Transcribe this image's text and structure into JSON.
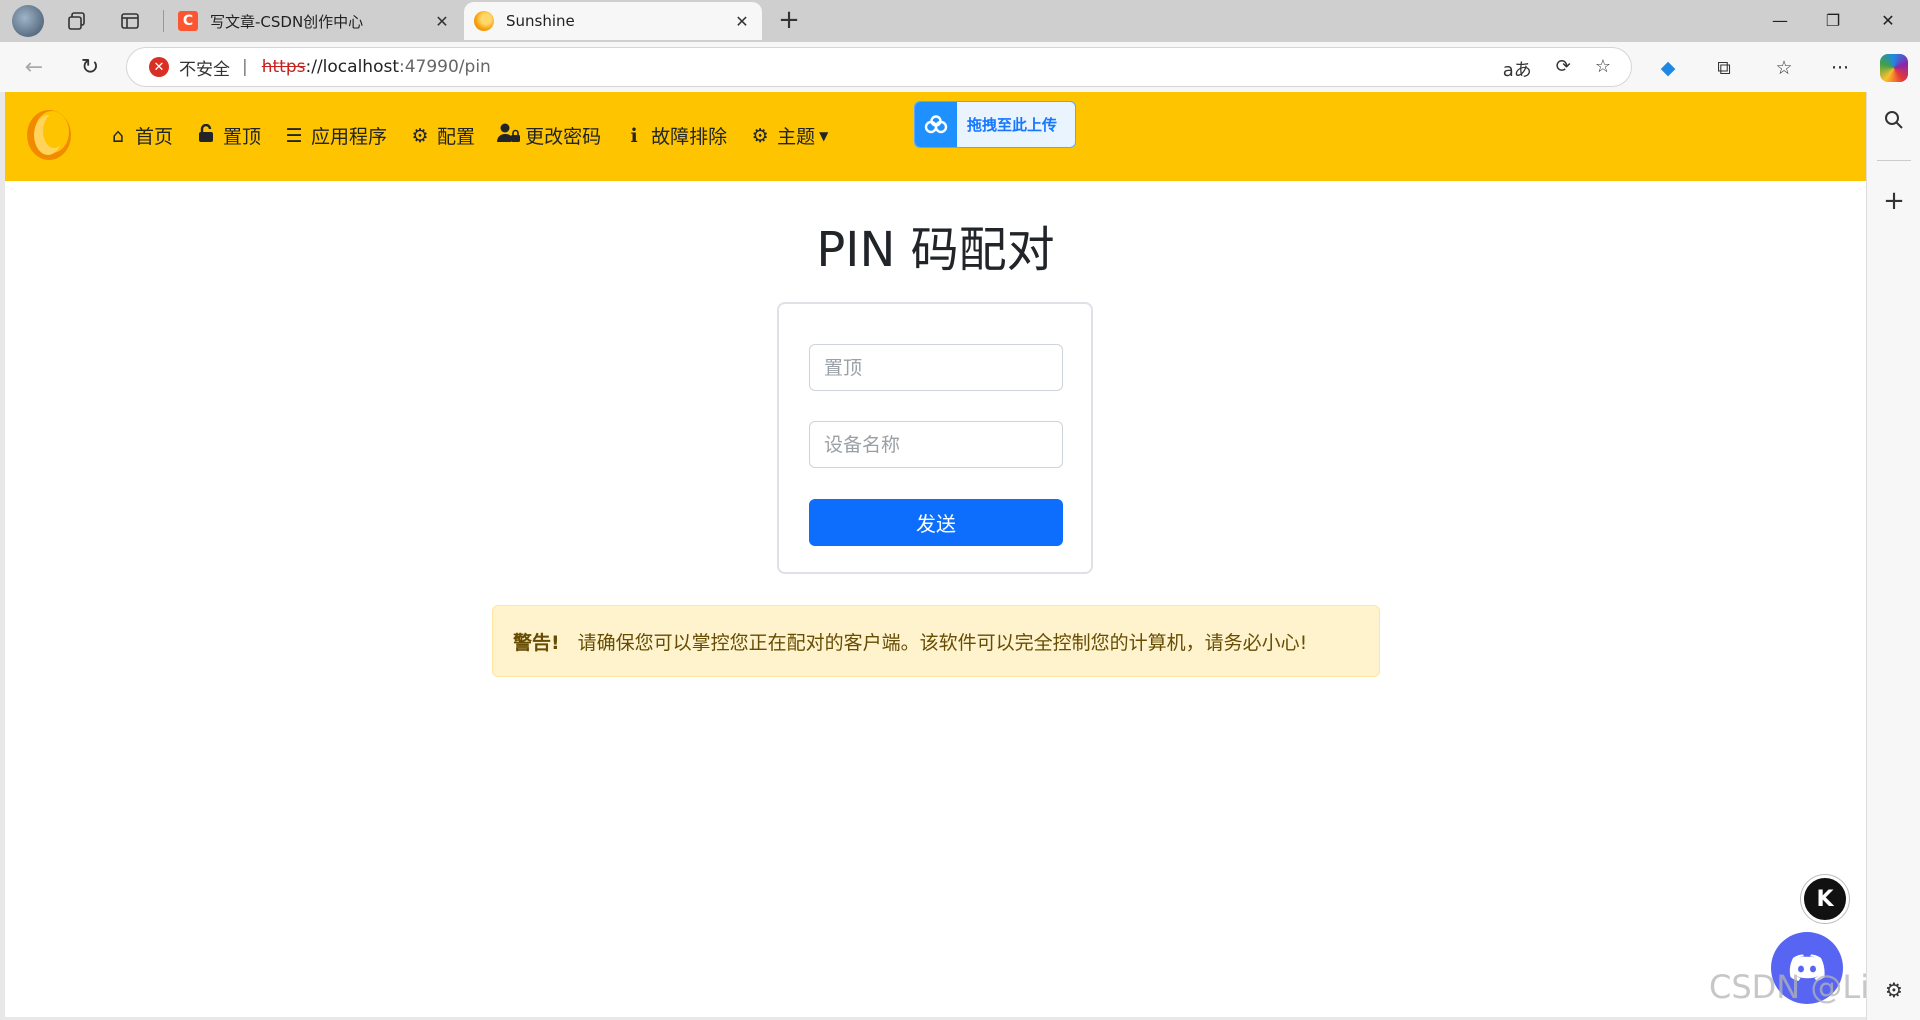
{
  "browser": {
    "tabs": [
      {
        "title": "写文章-CSDN创作中心",
        "favicon": "csdn-icon",
        "active": false
      },
      {
        "title": "Sunshine",
        "favicon": "sunshine-icon",
        "active": true
      }
    ],
    "security_label": "不安全",
    "url": {
      "scheme": "https",
      "host": "://localhost",
      "rest": ":47990/pin"
    }
  },
  "navbar": {
    "items": [
      {
        "label": "首页",
        "icon": "home-icon"
      },
      {
        "label": "置顶",
        "icon": "lock-icon"
      },
      {
        "label": "应用程序",
        "icon": "list-icon"
      },
      {
        "label": "配置",
        "icon": "gear-icon"
      },
      {
        "label": "更改密码",
        "icon": "user-lock-icon"
      },
      {
        "label": "故障排除",
        "icon": "info-icon"
      },
      {
        "label": "主题",
        "icon": "gear-icon"
      }
    ],
    "upload_label": "拖拽至此上传"
  },
  "page": {
    "title": "PIN 码配对",
    "pin_placeholder": "置顶",
    "device_placeholder": "设备名称",
    "send_label": "发送",
    "alert_strong": "警告!",
    "alert_text": "请确保您可以掌控您正在配对的客户端。该软件可以完全控制您的计算机，请务必小心!"
  },
  "watermark": "CSDN @Li Zi",
  "colors": {
    "navbar": "#ffc400",
    "primary": "#0d6efd",
    "alert_bg": "#fff3cd",
    "discord": "#5865f2"
  }
}
